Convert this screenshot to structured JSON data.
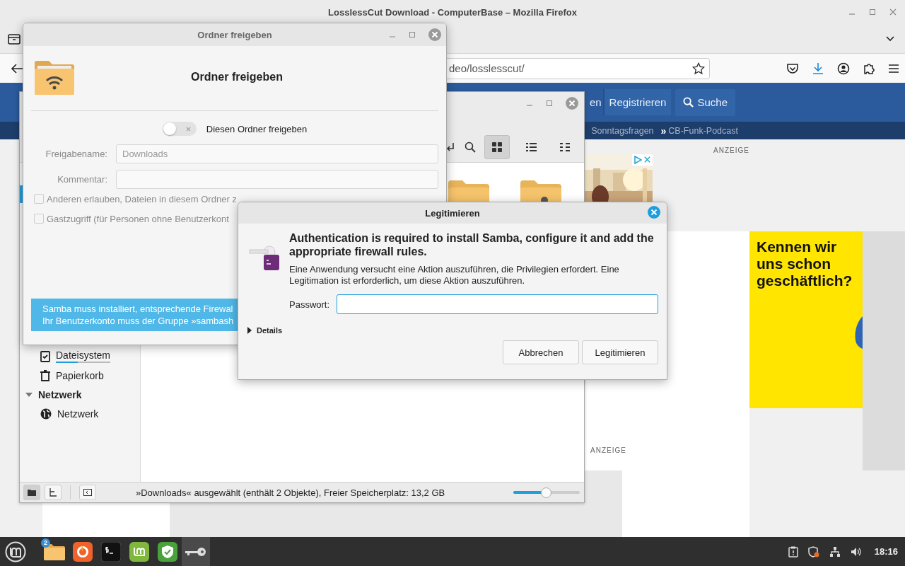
{
  "browser": {
    "title": "LosslessCut Download - ComputerBase – Mozilla Firefox",
    "url": "deo/losslesscut/",
    "site_nav": [
      {
        "label": "en"
      },
      {
        "label": "Registrieren"
      }
    ],
    "search_button": "Suche",
    "subnav": [
      {
        "label": "Sonntagsfragen"
      },
      {
        "marker": "»",
        "label": "CB-Funk-Podcast"
      }
    ],
    "ad_labels": [
      "ANZEIGE",
      "ANZEIGE"
    ],
    "banner_ad": {
      "headline": "Kennen wir uns schon geschäftlich?"
    }
  },
  "file_manager": {
    "view_buttons": [
      {
        "selected": true
      },
      {
        "selected": false
      },
      {
        "selected": false
      }
    ],
    "sidebar": [
      {
        "kind": "drive",
        "label": "Dateisystem",
        "level": 0.4
      },
      {
        "kind": "trash",
        "label": "Papierkorb"
      },
      {
        "kind": "header",
        "label": "Netzwerk",
        "expanded": true
      },
      {
        "kind": "network",
        "label": "Netzwerk"
      }
    ],
    "pane_buttons": [
      {
        "selected": true
      },
      {
        "selected": false
      }
    ],
    "status": "»Downloads« ausgewählt (enthält 2 Objekte), Freier Speicherplatz: 13,2 GB",
    "zoom": {
      "level": 0.49
    }
  },
  "share_dialog": {
    "title": "Ordner freigeben",
    "heading": "Ordner freigeben",
    "share_toggle": {
      "label": "Diesen Ordner freigeben",
      "on": false
    },
    "fields": [
      {
        "label": "Freigabename:",
        "value": "Downloads",
        "disabled": true
      },
      {
        "label": "Kommentar:",
        "disabled": true
      }
    ],
    "options": [
      {
        "label": "Anderen erlauben, Dateien in diesem Ordner z",
        "checked": false,
        "disabled": true
      },
      {
        "label": "Gastzugriff (für Personen ohne Benutzerkont",
        "checked": false,
        "disabled": true
      }
    ],
    "info": [
      "Samba muss installiert, entsprechende Firewal",
      "Ihr Benutzerkonto muss der Gruppe »sambash"
    ]
  },
  "auth_dialog": {
    "title": "Legitimieren",
    "heading": "Authentication is required to install Samba, configure it and add the appropriate firewall rules.",
    "message": "Eine Anwendung versucht eine Aktion auszuführen, die Privilegien erfordert. Eine Legitimation ist erforderlich, um diese Aktion auszuführen.",
    "password_label": "Passwort:",
    "details": {
      "label": "Details",
      "expanded": false
    },
    "buttons": [
      {
        "label": "Abbrechen"
      },
      {
        "label": "Legitimieren"
      }
    ]
  },
  "taskbar": {
    "apps": [
      {
        "kind": "files",
        "badge": "2",
        "selected": false
      },
      {
        "kind": "firefox",
        "selected": false
      },
      {
        "kind": "terminal",
        "selected": false
      },
      {
        "kind": "update",
        "selected": false
      },
      {
        "kind": "shield",
        "selected": false
      },
      {
        "kind": "key",
        "selected": true
      }
    ],
    "clock": "18:16"
  }
}
